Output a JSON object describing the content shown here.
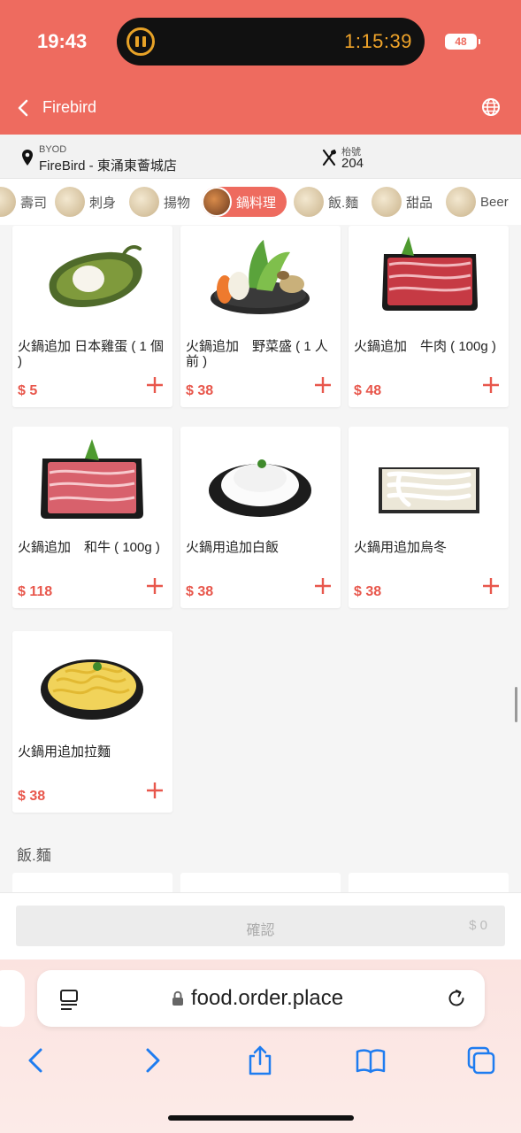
{
  "status_bar": {
    "time": "19:43",
    "timer": "1:15:39",
    "battery": "48"
  },
  "header": {
    "title": "Firebird"
  },
  "info_bar": {
    "byod_label": "BYOD",
    "store_name": "FireBird - 東涌東薈城店",
    "table_label": "枱號",
    "table_number": "204"
  },
  "categories": [
    {
      "label": "壽司",
      "active": false
    },
    {
      "label": "刺身",
      "active": false
    },
    {
      "label": "揚物",
      "active": false
    },
    {
      "label": "鍋料理",
      "active": true
    },
    {
      "label": "飯.麵",
      "active": false
    },
    {
      "label": "甜品",
      "active": false
    },
    {
      "label": "Beer",
      "active": false
    }
  ],
  "products": [
    {
      "name": "火鍋追加 日本雞蛋 ( 1 個 )",
      "price": "$ 5"
    },
    {
      "name": "火鍋追加　野菜盛 ( 1 人前 )",
      "price": "$ 38"
    },
    {
      "name": "火鍋追加　牛肉 ( 100g )",
      "price": "$ 48"
    },
    {
      "name": "火鍋追加　和牛 ( 100g )",
      "price": "$ 118"
    },
    {
      "name": "火鍋用追加白飯",
      "price": "$ 38"
    },
    {
      "name": "火鍋用追加烏冬",
      "price": "$ 38"
    },
    {
      "name": "火鍋用追加拉麵",
      "price": "$ 38"
    }
  ],
  "next_section_title": "飯.麵",
  "confirm": {
    "label": "確認",
    "total": "$ 0"
  },
  "browser": {
    "url": "food.order.place"
  },
  "colors": {
    "brand": "#ee6b5f",
    "price": "#e8574c",
    "timer": "#f0a42a"
  }
}
